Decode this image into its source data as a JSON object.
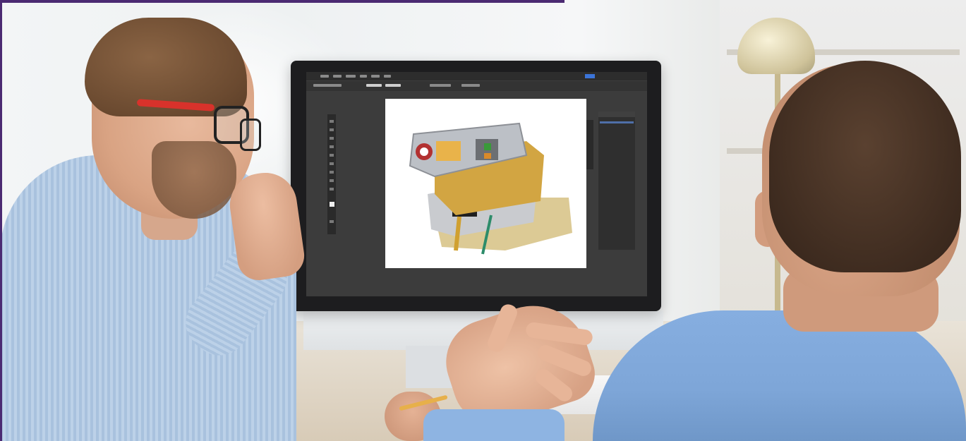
{
  "scene": {
    "description_icons": [
      "photo"
    ],
    "colors": {
      "accent_bar": "#4b2a72",
      "screen_ui": "#3c3c3c",
      "artboard": "#ffffff",
      "shirt_left": "#bcd1e8",
      "shirt_right": "#86aee0",
      "glasses": "#d8322b"
    }
  }
}
